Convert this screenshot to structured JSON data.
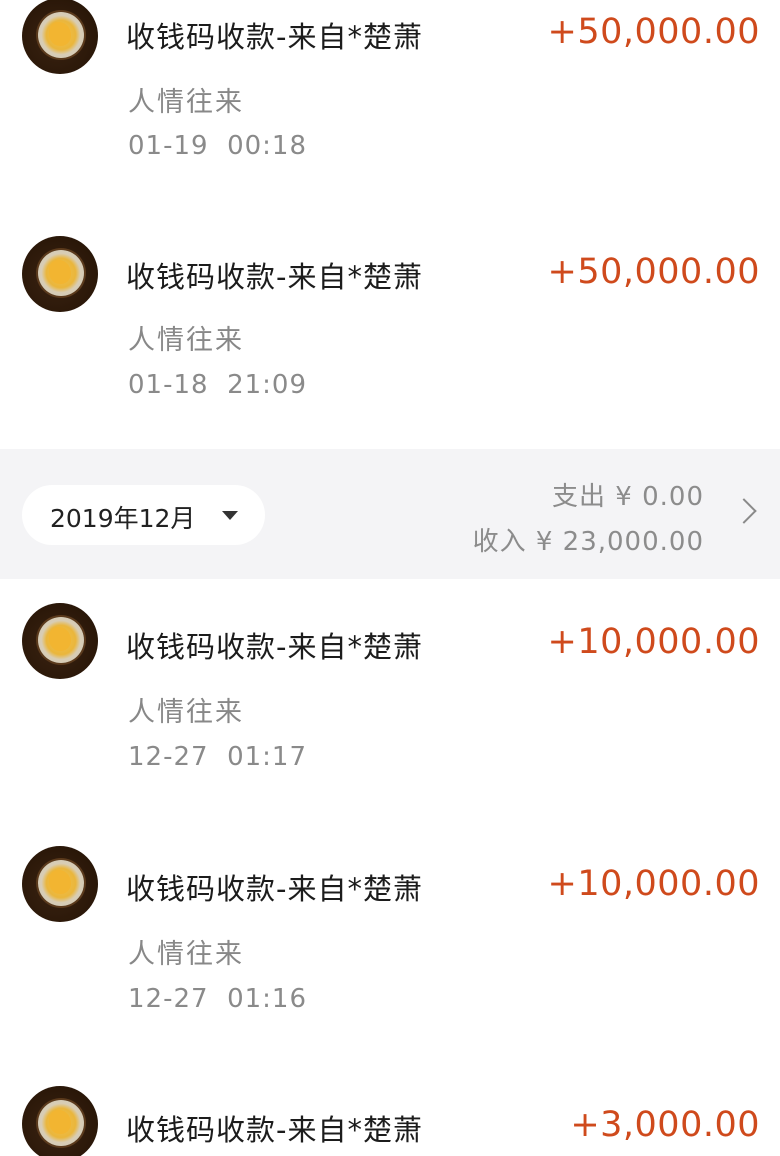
{
  "transactions_top": [
    {
      "title": "收钱码收款-来自*楚萧",
      "amount": "+50,000.00",
      "category": "人情往来",
      "time": "01-19  00:18"
    },
    {
      "title": "收钱码收款-来自*楚萧",
      "amount": "+50,000.00",
      "category": "人情往来",
      "time": "01-18  21:09"
    }
  ],
  "month_header": {
    "month": "2019年12月",
    "expense": "支出 ¥ 0.00",
    "income": "收入 ¥ 23,000.00",
    "dropdown_icon": "caret-down-icon",
    "chevron_icon": "chevron-right-icon"
  },
  "transactions_bottom": [
    {
      "title": "收钱码收款-来自*楚萧",
      "amount": "+10,000.00",
      "category": "人情往来",
      "time": "12-27  01:17"
    },
    {
      "title": "收钱码收款-来自*楚萧",
      "amount": "+10,000.00",
      "category": "人情往来",
      "time": "12-27  01:16"
    },
    {
      "title": "收钱码收款-来自*楚萧",
      "amount": "+3,000.00"
    }
  ],
  "colors": {
    "amount": "#cf4a1c",
    "title": "#1c1c1c",
    "secondary_text": "#888888",
    "month_bar_bg": "#f4f4f6"
  }
}
